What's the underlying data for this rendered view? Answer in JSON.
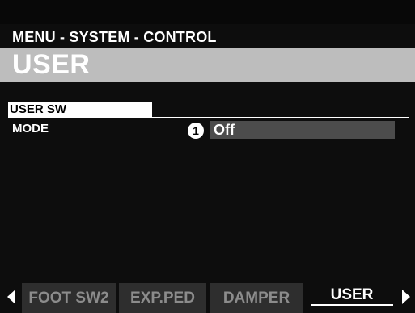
{
  "header": {
    "breadcrumb": "MENU - SYSTEM - CONTROL",
    "title": "USER"
  },
  "section": {
    "label": "USER SW"
  },
  "parameters": [
    {
      "label": "MODE",
      "marker": "1",
      "value": "Off"
    }
  ],
  "tabs": [
    {
      "label": "FOOT SW2",
      "active": false
    },
    {
      "label": "EXP.PED",
      "active": false
    },
    {
      "label": "DAMPER",
      "active": false
    },
    {
      "label": "USER",
      "active": true
    }
  ],
  "nav": {
    "left_icon": "triangle-left-icon",
    "right_icon": "triangle-right-icon"
  },
  "colors": {
    "screen_bg": "#0d0d0d",
    "title_bar": "#bdbdbd",
    "value_field": "#4c4c4c",
    "inactive_tab": "#2e2e2e",
    "inactive_tab_text": "#8c8c8c",
    "text": "#ffffff"
  }
}
